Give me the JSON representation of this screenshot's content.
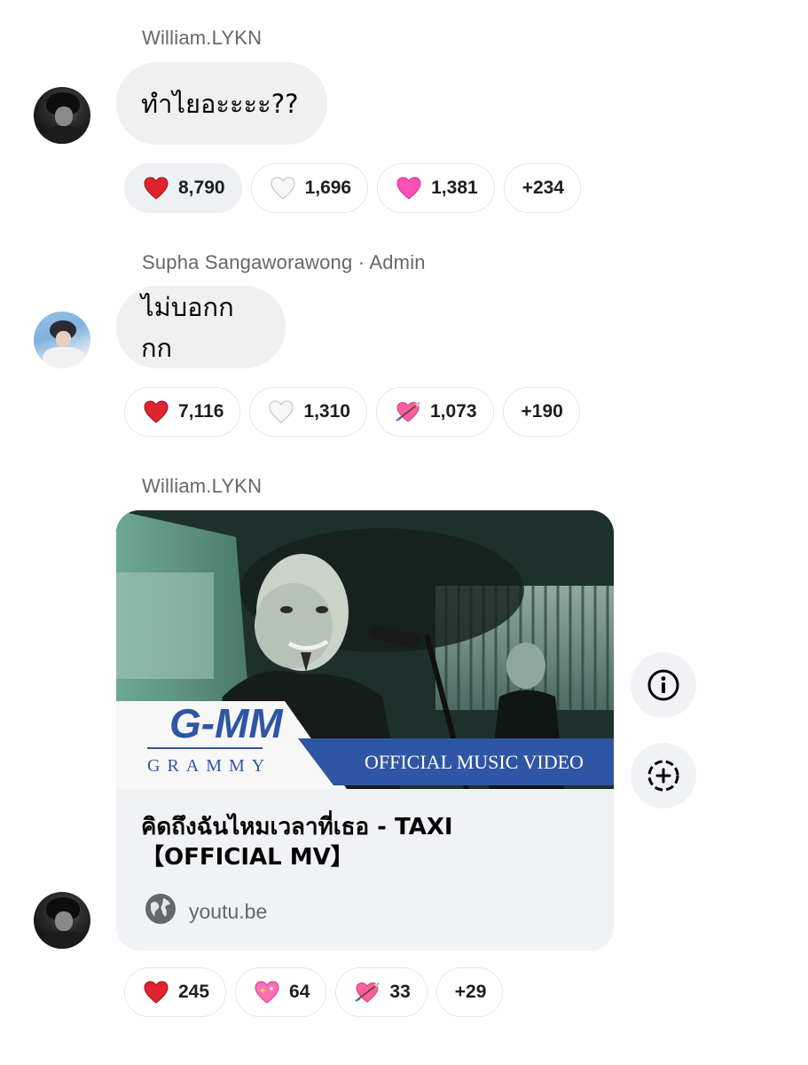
{
  "messages": [
    {
      "sender": "William.LYKN",
      "text": "ทำไยอะะะะ??",
      "reactions": [
        {
          "emoji": "red-heart",
          "count": "8,790"
        },
        {
          "emoji": "white-heart",
          "count": "1,696"
        },
        {
          "emoji": "pink-heart",
          "count": "1,381"
        },
        {
          "emoji": "more",
          "count": "+234"
        }
      ]
    },
    {
      "sender": "Supha Sangaworawong · Admin",
      "text": "ไม่บอกกกก",
      "reactions": [
        {
          "emoji": "red-heart",
          "count": "7,116"
        },
        {
          "emoji": "white-heart",
          "count": "1,310"
        },
        {
          "emoji": "heart-with-arrow",
          "count": "1,073"
        },
        {
          "emoji": "more",
          "count": "+190"
        }
      ]
    },
    {
      "sender": "William.LYKN",
      "link": {
        "title_line1": "คิดถึงฉันไหมเวลาที่เธอ - TAXI",
        "title_line2": "【OFFICIAL MV】",
        "domain": "youtu.be",
        "thumbnail": {
          "logo": "G-MM",
          "logo_sub": "GRAMMY",
          "banner": "OFFICIAL MUSIC VIDEO"
        }
      },
      "reactions": [
        {
          "emoji": "red-heart",
          "count": "245"
        },
        {
          "emoji": "sparkling-heart",
          "count": "64"
        },
        {
          "emoji": "heart-with-arrow",
          "count": "33"
        },
        {
          "emoji": "more",
          "count": "+29"
        }
      ]
    }
  ],
  "side_actions": {
    "info": "info-icon",
    "add": "add-reaction-icon"
  },
  "colors": {
    "bubble": "#f0f0f0",
    "sender_gray": "#65676b",
    "red_heart": "#e0242f",
    "pink_heart": "#ff4fb8",
    "gmm_blue": "#2f56a4"
  }
}
